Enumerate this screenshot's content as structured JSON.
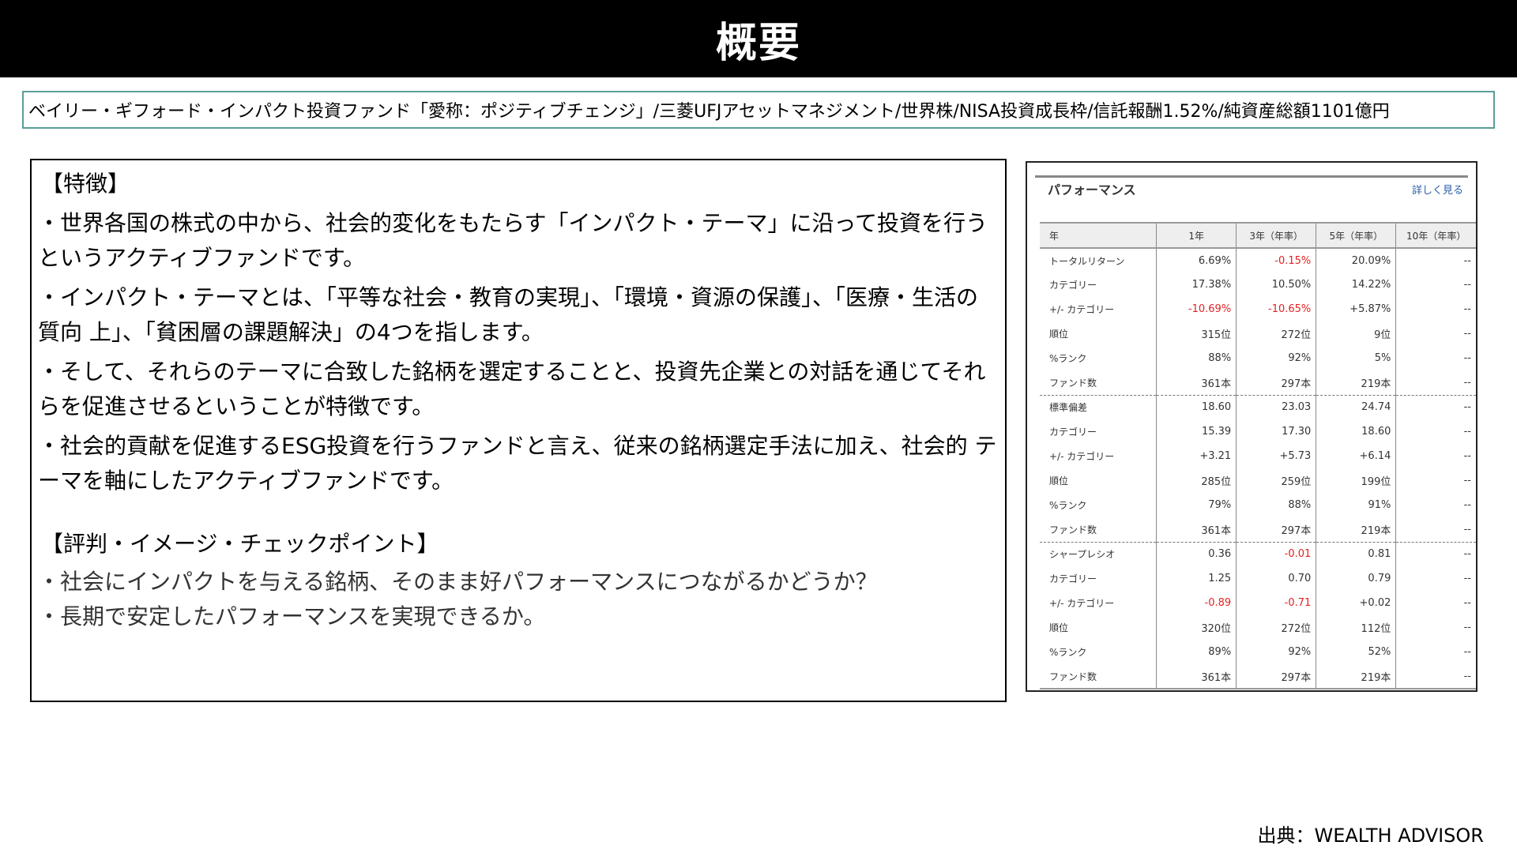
{
  "title": "概要",
  "summary": "ベイリー・ギフォード・インパクト投資ファンド「愛称：ポジティブチェンジ」/三菱UFJアセットマネジメント/世界株/NISA投資成長枠/信託報酬1.52%/純資産総額1101億円",
  "features": {
    "heading": "【特徴】",
    "bullets": [
      "・世界各国の株式の中から、社会的変化をもたらす「インパクト・テーマ」に沿って投資を行うというアクティブファンドです。",
      "・インパクト・テーマとは、「平等な社会・教育の実現」、「環境・資源の保護」、「医療・生活の質向 上」、「貧困層の課題解決」の4つを指します。",
      "・そして、それらのテーマに合致した銘柄を選定することと、投資先企業との対話を通じてそれらを促進させるということが特徴です。",
      "・社会的貢献を促進するESG投資を行うファンドと言え、従来の銘柄選定手法に加え、社会的 テーマを軸にしたアクティブファンドです。"
    ]
  },
  "checkpoints": {
    "heading": "【評判・イメージ・チェックポイント】",
    "items": [
      "・社会にインパクトを与える銘柄、そのまま好パフォーマンスにつながるかどうか？",
      "・長期で安定したパフォーマンスを実現できるか。"
    ]
  },
  "performance": {
    "title": "パフォーマンス",
    "more_link": "詳しく見る",
    "columns": [
      "年",
      "1年",
      "3年（年率）",
      "5年（年率）",
      "10年（年率）"
    ],
    "rows": [
      {
        "label": "トータルリターン",
        "values": [
          "6.69%",
          "-0.15%",
          "20.09%",
          "--"
        ]
      },
      {
        "label": "カテゴリー",
        "values": [
          "17.38%",
          "10.50%",
          "14.22%",
          "--"
        ]
      },
      {
        "label": "+/- カテゴリー",
        "values": [
          "-10.69%",
          "-10.65%",
          "+5.87%",
          "--"
        ]
      },
      {
        "label": "順位",
        "values": [
          "315位",
          "272位",
          "9位",
          "--"
        ]
      },
      {
        "label": "%ランク",
        "values": [
          "88%",
          "92%",
          "5%",
          "--"
        ]
      },
      {
        "label": "ファンド数",
        "values": [
          "361本",
          "297本",
          "219本",
          "--"
        ]
      },
      {
        "label": "標準偏差",
        "values": [
          "18.60",
          "23.03",
          "24.74",
          "--"
        ]
      },
      {
        "label": "カテゴリー",
        "values": [
          "15.39",
          "17.30",
          "18.60",
          "--"
        ]
      },
      {
        "label": "+/- カテゴリー",
        "values": [
          "+3.21",
          "+5.73",
          "+6.14",
          "--"
        ]
      },
      {
        "label": "順位",
        "values": [
          "285位",
          "259位",
          "199位",
          "--"
        ]
      },
      {
        "label": "%ランク",
        "values": [
          "79%",
          "88%",
          "91%",
          "--"
        ]
      },
      {
        "label": "ファンド数",
        "values": [
          "361本",
          "297本",
          "219本",
          "--"
        ]
      },
      {
        "label": "シャープレシオ",
        "values": [
          "0.36",
          "-0.01",
          "0.81",
          "--"
        ]
      },
      {
        "label": "カテゴリー",
        "values": [
          "1.25",
          "0.70",
          "0.79",
          "--"
        ]
      },
      {
        "label": "+/- カテゴリー",
        "values": [
          "-0.89",
          "-0.71",
          "+0.02",
          "--"
        ]
      },
      {
        "label": "順位",
        "values": [
          "320位",
          "272位",
          "112位",
          "--"
        ]
      },
      {
        "label": "%ランク",
        "values": [
          "89%",
          "92%",
          "52%",
          "--"
        ]
      },
      {
        "label": "ファンド数",
        "values": [
          "361本",
          "297本",
          "219本",
          "--"
        ]
      }
    ],
    "negative_color": "#e32222"
  },
  "source": "出典：WEALTH ADVISOR"
}
